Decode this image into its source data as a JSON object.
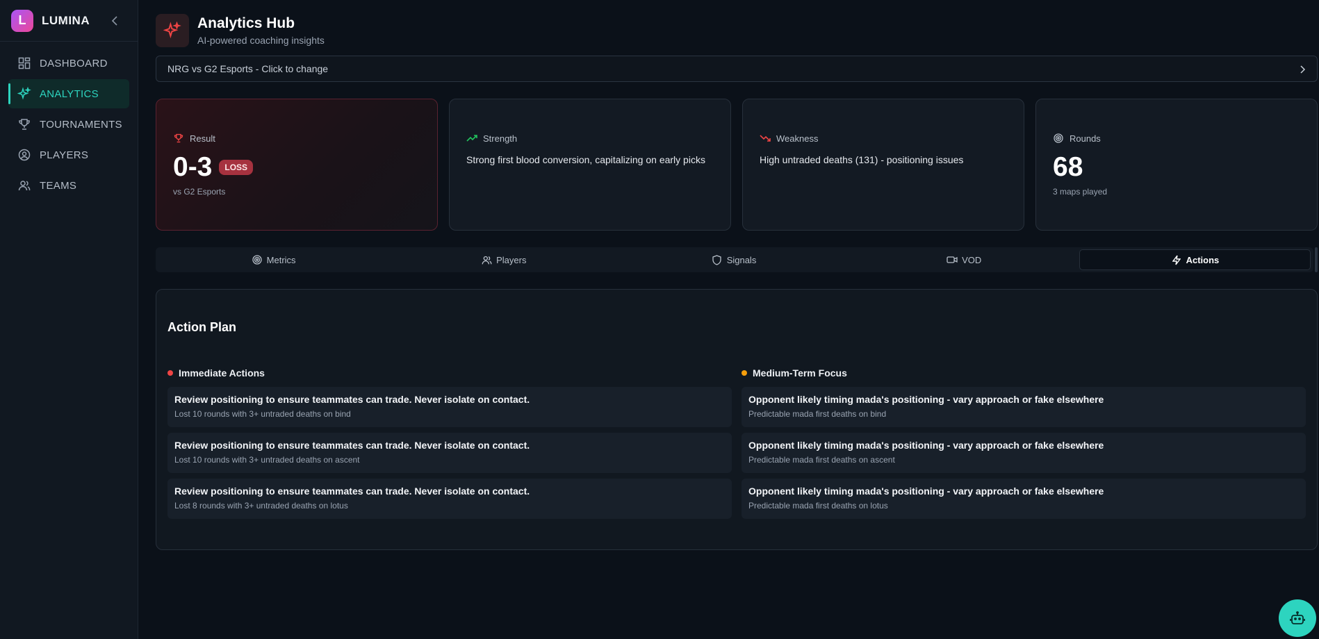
{
  "app": {
    "name": "LUMINA",
    "logo_letter": "L"
  },
  "sidebar": {
    "items": [
      {
        "label": "DASHBOARD",
        "icon": "grid-icon",
        "active": false
      },
      {
        "label": "ANALYTICS",
        "icon": "sparkles-icon",
        "active": true
      },
      {
        "label": "TOURNAMENTS",
        "icon": "trophy-icon",
        "active": false
      },
      {
        "label": "PLAYERS",
        "icon": "user-circle-icon",
        "active": false
      },
      {
        "label": "TEAMS",
        "icon": "users-icon",
        "active": false
      }
    ]
  },
  "header": {
    "title": "Analytics Hub",
    "subtitle": "AI-powered coaching insights"
  },
  "match_selector": {
    "label": "NRG vs G2 Esports - Click to change"
  },
  "cards": {
    "result": {
      "label": "Result",
      "value": "0-3",
      "badge": "LOSS",
      "sub": "vs G2 Esports"
    },
    "strength": {
      "label": "Strength",
      "text": "Strong first blood conversion, capitalizing on early picks"
    },
    "weakness": {
      "label": "Weakness",
      "text": "High untraded deaths (131) - positioning issues"
    },
    "rounds": {
      "label": "Rounds",
      "value": "68",
      "sub": "3 maps played"
    }
  },
  "tabs": [
    {
      "label": "Metrics",
      "icon": "target-icon"
    },
    {
      "label": "Players",
      "icon": "users-icon"
    },
    {
      "label": "Signals",
      "icon": "shield-icon"
    },
    {
      "label": "VOD",
      "icon": "video-icon"
    },
    {
      "label": "Actions",
      "icon": "zap-icon",
      "active": true
    }
  ],
  "action_plan": {
    "title": "Action Plan",
    "immediate": {
      "heading": "Immediate Actions",
      "items": [
        {
          "title": "Review positioning to ensure teammates can trade. Never isolate on contact.",
          "sub": "Lost 10 rounds with 3+ untraded deaths on bind"
        },
        {
          "title": "Review positioning to ensure teammates can trade. Never isolate on contact.",
          "sub": "Lost 10 rounds with 3+ untraded deaths on ascent"
        },
        {
          "title": "Review positioning to ensure teammates can trade. Never isolate on contact.",
          "sub": "Lost 8 rounds with 3+ untraded deaths on lotus"
        }
      ]
    },
    "medium": {
      "heading": "Medium-Term Focus",
      "items": [
        {
          "title": "Opponent likely timing mada's positioning - vary approach or fake elsewhere",
          "sub": "Predictable mada first deaths on bind"
        },
        {
          "title": "Opponent likely timing mada's positioning - vary approach or fake elsewhere",
          "sub": "Predictable mada first deaths on ascent"
        },
        {
          "title": "Opponent likely timing mada's positioning - vary approach or fake elsewhere",
          "sub": "Predictable mada first deaths on lotus"
        }
      ]
    }
  },
  "colors": {
    "accent": "#2dd4bf",
    "loss": "#a6323f",
    "immediate": "#ef4444",
    "medium": "#f59e0b"
  }
}
